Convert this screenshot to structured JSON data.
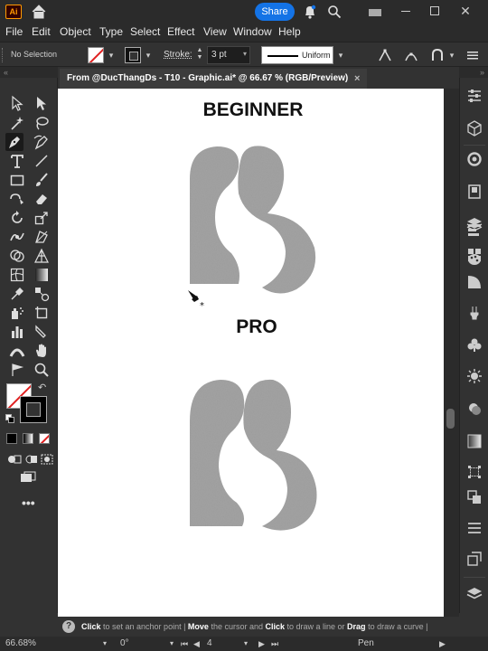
{
  "app": {
    "logo_text": "Ai",
    "share_label": "Share"
  },
  "menu": [
    "File",
    "Edit",
    "Object",
    "Type",
    "Select",
    "Effect",
    "View",
    "Window",
    "Help"
  ],
  "control_bar": {
    "selection_text": "No Selection",
    "stroke_label": "Stroke:",
    "stroke_value": "3 pt",
    "profile_label": "Uniform"
  },
  "document": {
    "tab_title": "From @DucThangDs - T10 - Graphic.ai* @ 66.67 % (RGB/Preview)",
    "close_glyph": "×"
  },
  "artboard": {
    "heading_top": "BEGINNER",
    "heading_bottom": "PRO"
  },
  "hint": {
    "q": "?",
    "p1_bold": "Click",
    "p1": " to set an anchor point  |  ",
    "p2_bold": "Move",
    "p2": " the cursor and ",
    "p3_bold": "Click",
    "p3": " to draw a line or ",
    "p4_bold": "Drag",
    "p4": " to draw a curve  |  "
  },
  "status": {
    "zoom": "66.68%",
    "rotation": "0°",
    "artboard_num": "4",
    "tool_name": "Pen"
  },
  "colors": {
    "accent": "#1473e6",
    "logo_orange": "#ff9a00",
    "shape_gray": "#a3a3a3"
  }
}
